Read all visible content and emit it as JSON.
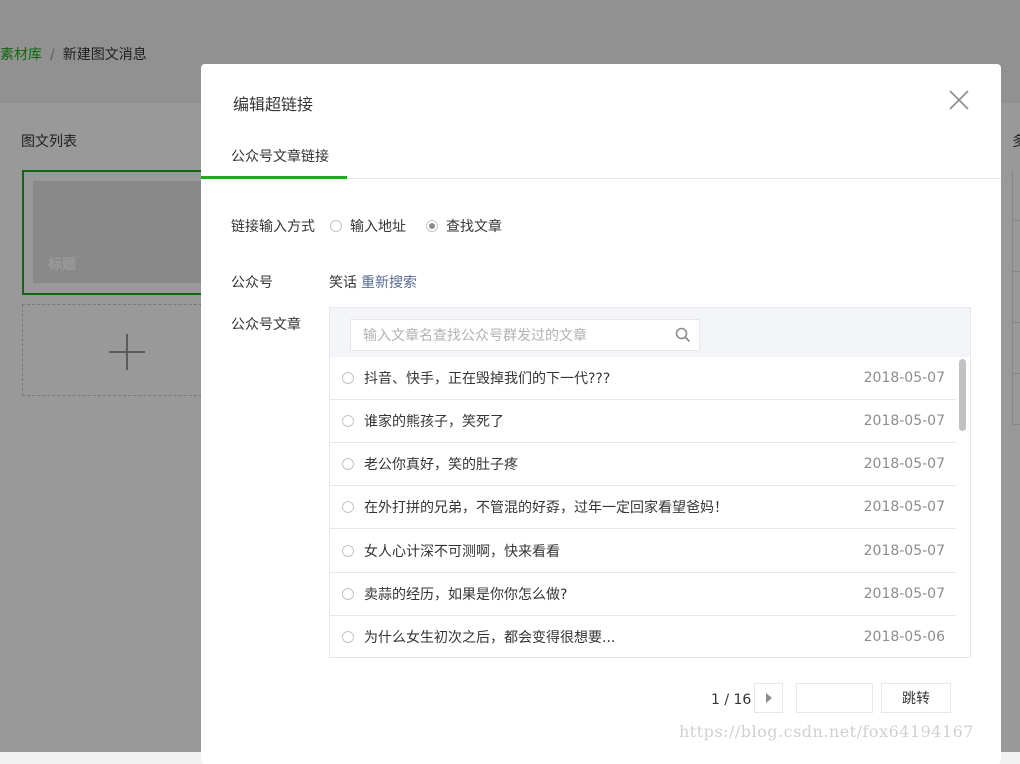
{
  "page": {
    "breadcrumb": {
      "link": "素材库",
      "sep": "/",
      "current": "新建图文消息"
    },
    "list_title": "图文列表",
    "card_title": "标题",
    "right_edge_text": "多"
  },
  "dialog": {
    "title": "编辑超链接",
    "tab": "公众号文章链接",
    "link_mode_label": "链接输入方式",
    "options": [
      {
        "label": "输入地址",
        "checked": false
      },
      {
        "label": "查找文章",
        "checked": true
      }
    ],
    "account_label": "公众号",
    "account_name": "笑话",
    "research_link": "重新搜索",
    "articles_label": "公众号文章",
    "search_placeholder": "输入文章名查找公众号群发过的文章",
    "articles": [
      {
        "title": "抖音、快手，正在毁掉我们的下一代???",
        "date": "2018-05-07"
      },
      {
        "title": "谁家的熊孩子，笑死了",
        "date": "2018-05-07"
      },
      {
        "title": "老公你真好，笑的肚子疼",
        "date": "2018-05-07"
      },
      {
        "title": "在外打拼的兄弟，不管混的好孬，过年一定回家看望爸妈！",
        "date": "2018-05-07"
      },
      {
        "title": "女人心计深不可测啊，快来看看",
        "date": "2018-05-07"
      },
      {
        "title": "卖蒜的经历，如果是你你怎么做?",
        "date": "2018-05-07"
      },
      {
        "title": "为什么女生初次之后，都会变得很想要...",
        "date": "2018-05-06"
      }
    ],
    "pager": {
      "info": "1 / 16",
      "jump_label": "跳转"
    }
  },
  "watermark": "https://blog.csdn.net/fox64194167",
  "colors": {
    "accent": "#1aad19",
    "link": "#576b95"
  }
}
